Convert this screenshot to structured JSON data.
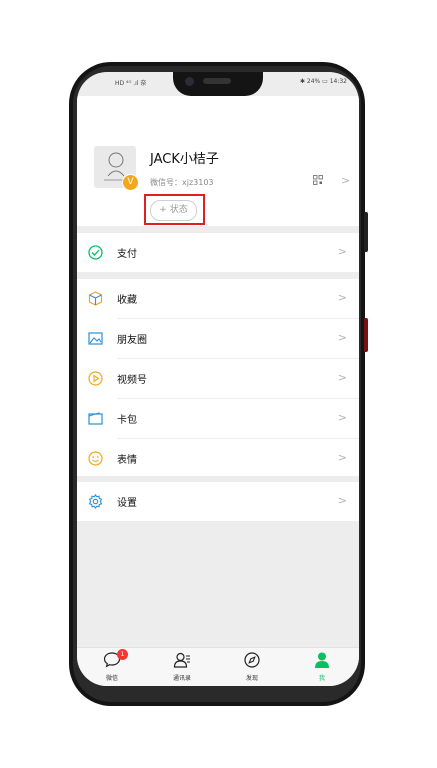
{
  "status_bar": {
    "left": "HD ⁴ᴳ .ıl 奈",
    "right": "✱ 24% ▭ 14:32"
  },
  "profile": {
    "nickname": "JACK小桔子",
    "wechat_id": "微信号：xjz3103",
    "status_button": "+ 状态",
    "badge_letter": "V"
  },
  "menu": {
    "pay": "支付",
    "favorites": "收藏",
    "moments": "朋友圈",
    "channels": "视频号",
    "cards": "卡包",
    "stickers": "表情",
    "settings": "设置"
  },
  "tabbar": {
    "chats": "微信",
    "chats_badge": "1",
    "contacts": "通讯录",
    "discover": "发现",
    "me": "我"
  },
  "colors": {
    "accent_green": "#07c160",
    "highlight_red": "#e0201f",
    "badge_red": "#f43530"
  }
}
